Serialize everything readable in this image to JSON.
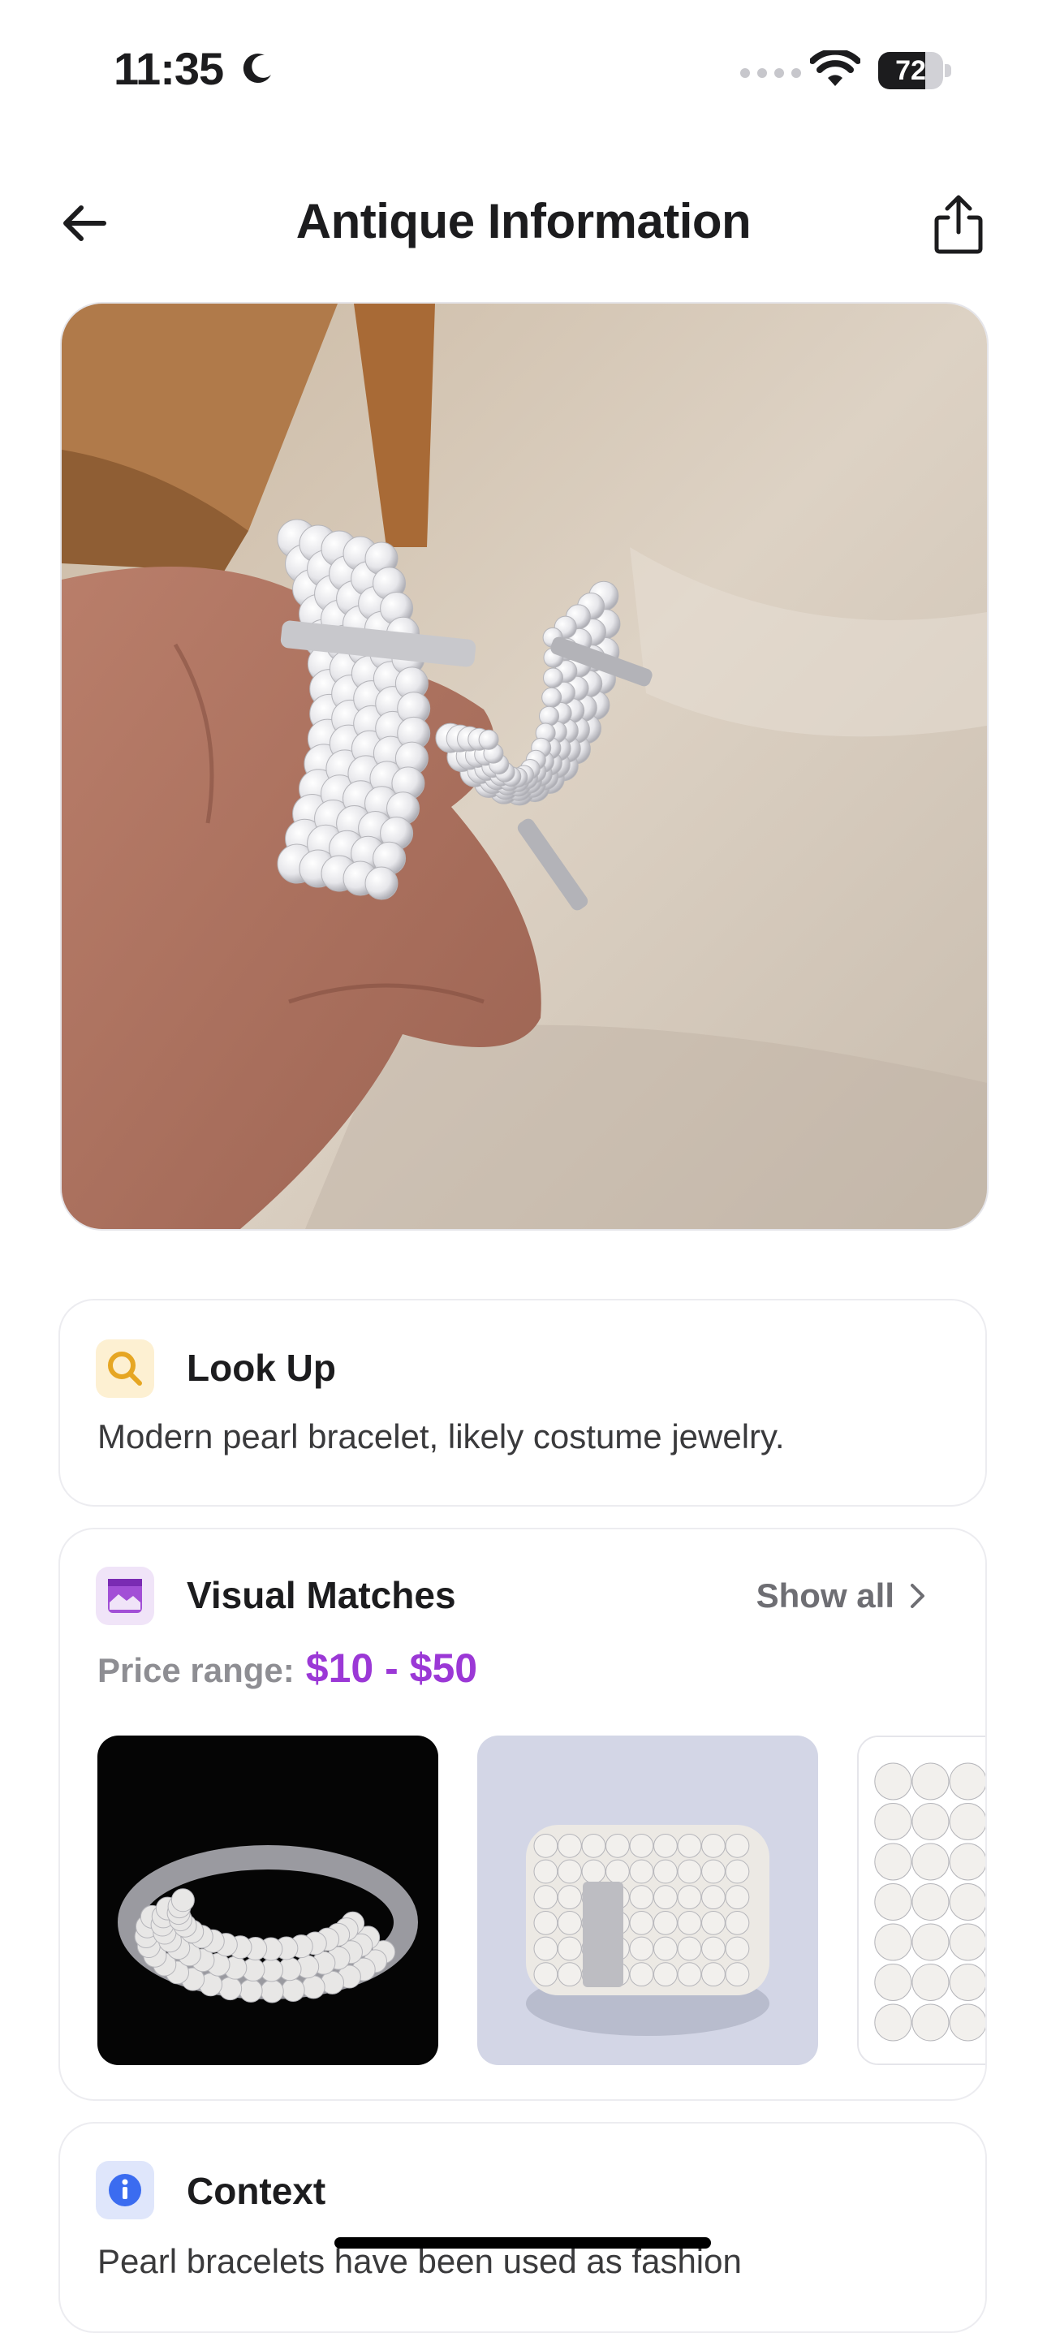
{
  "status_bar": {
    "time": "11:35",
    "battery_percent": "72",
    "battery_level": 0.72,
    "icons": [
      "moon-icon",
      "signal-dots-icon",
      "wifi-icon",
      "battery-icon"
    ]
  },
  "header": {
    "title": "Antique Information",
    "back_icon": "arrow-left-icon",
    "share_icon": "share-icon"
  },
  "lookup": {
    "title": "Look Up",
    "text": "Modern pearl bracelet, likely costume jewelry.",
    "icon": "search-icon",
    "icon_color": "#e6a623"
  },
  "visual_matches": {
    "title": "Visual Matches",
    "show_all": "Show all",
    "price_label": "Price range:",
    "price_value": "$10 - $50",
    "icon": "image-icon",
    "accent": "#9b38d6"
  },
  "context": {
    "title": "Context",
    "text": "Pearl bracelets have been used as fashion",
    "icon": "info-icon",
    "icon_color": "#3b6cf0"
  }
}
